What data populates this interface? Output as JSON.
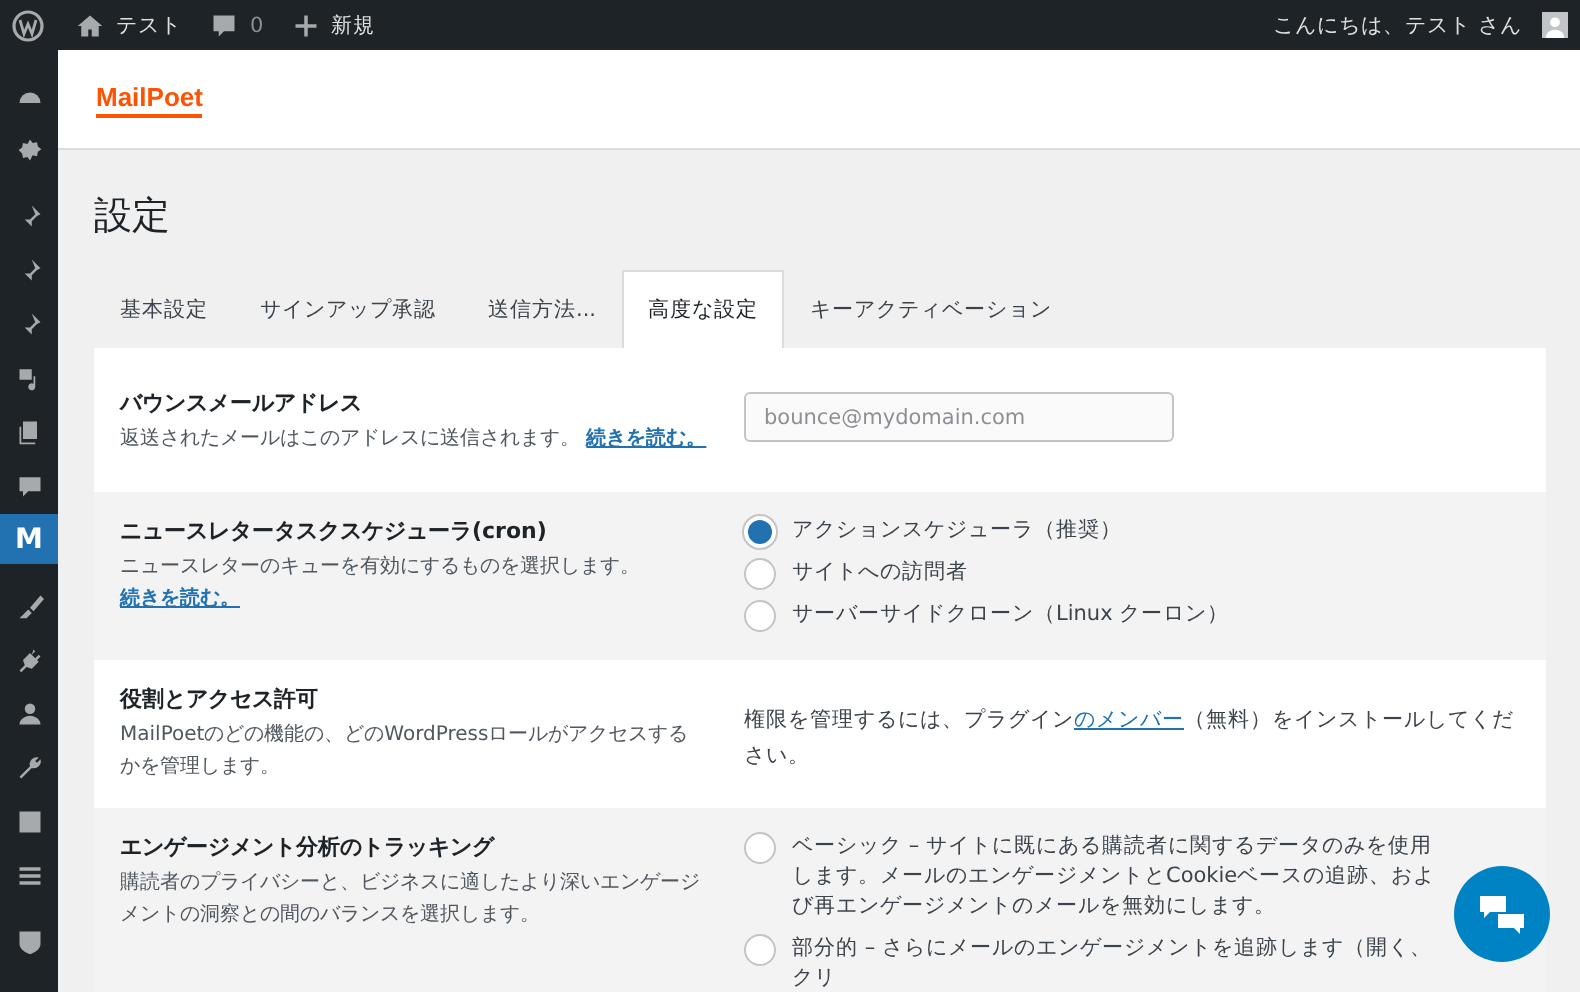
{
  "admin_bar": {
    "site_name": "テスト",
    "comments_count": "0",
    "new_label": "新規",
    "greeting": "こんにちは、テスト さん"
  },
  "sidebar": {
    "items": [
      {
        "selected": false
      },
      {
        "selected": false
      },
      {
        "selected": false
      },
      {
        "selected": false
      },
      {
        "selected": false
      },
      {
        "selected": false
      },
      {
        "selected": false
      },
      {
        "selected": false
      },
      {
        "glyph": "M",
        "selected": true
      },
      {
        "selected": false
      },
      {
        "selected": false
      },
      {
        "selected": false
      },
      {
        "selected": false
      },
      {
        "selected": false
      },
      {
        "selected": false
      },
      {
        "selected": false
      }
    ]
  },
  "logo": "MailPoet",
  "page_title": "設定",
  "tabs": [
    {
      "label": "基本設定",
      "selected": false
    },
    {
      "label": "サインアップ承認",
      "selected": false
    },
    {
      "label": "送信方法...",
      "selected": false
    },
    {
      "label": "高度な設定",
      "selected": true
    },
    {
      "label": "キーアクティベーション",
      "selected": false
    }
  ],
  "settings": [
    {
      "title": "バウンスメールアドレス",
      "description": "返送されたメールはこのアドレスに送信されます。",
      "link": "続きを読む。",
      "control": {
        "kind": "input",
        "placeholder": "bounce@mydomain.com"
      }
    },
    {
      "title": "ニュースレタータスクスケジューラ(cron)",
      "description": "ニュースレターのキューを有効にするものを選択します。",
      "link": "続きを読む。",
      "control": {
        "kind": "radios",
        "options": [
          {
            "label": "アクションスケジューラ（推奨）",
            "selected": true
          },
          {
            "label": "サイトへの訪問者",
            "selected": false
          },
          {
            "label": "サーバーサイドクローン（Linux クーロン）",
            "selected": false
          }
        ]
      }
    },
    {
      "title": "役割とアクセス許可",
      "description": "MailPoetのどの機能の、どのWordPressロールがアクセスするかを管理します。",
      "control": {
        "kind": "text",
        "before": "権限を管理するには、プラグイン",
        "link": "のメンバー",
        "after": "（無料）をインストールしてください。"
      }
    },
    {
      "title": "エンゲージメント分析のトラッキング",
      "description": "購読者のプライバシーと、ビジネスに適したより深いエンゲージメントの洞察との間のバランスを選択します。",
      "control": {
        "kind": "radios",
        "options": [
          {
            "label": "ベーシック – サイトに既にある購読者に関するデータのみを使用します。メールのエンゲージメントとCookieベースの追跡、および再エンゲージメントのメールを無効にします。",
            "selected": false
          },
          {
            "label": "部分的 – さらにメールのエンゲージメントを追跡します（開く、クリ",
            "selected": false
          }
        ]
      }
    }
  ]
}
